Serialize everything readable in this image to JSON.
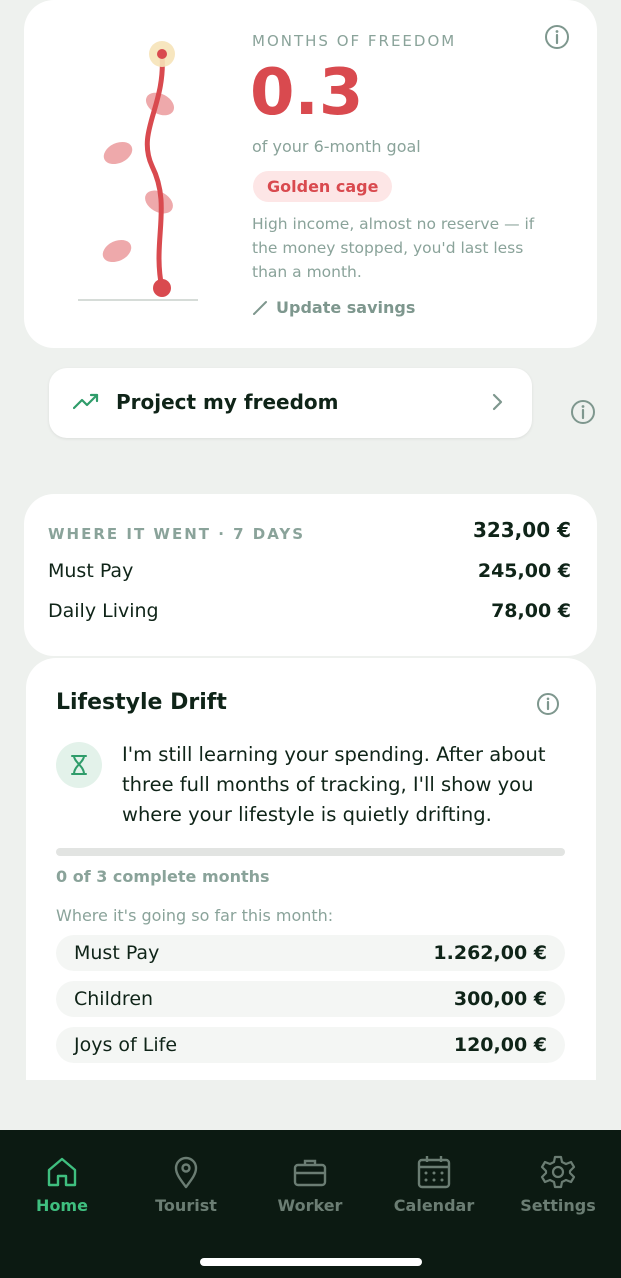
{
  "freedom": {
    "label": "MONTHS OF FREEDOM",
    "value": "0.3",
    "goal_text": "of your 6-month goal",
    "badge": "Golden cage",
    "description": "High income, almost no reserve — if the money stopped, you'd last less than a month.",
    "update_label": "Update savings"
  },
  "project": {
    "label": "Project my freedom"
  },
  "spending": {
    "heading": "WHERE IT WENT · 7 DAYS",
    "total": "323,00 €",
    "rows": [
      {
        "label": "Must Pay",
        "value": "245,00 €"
      },
      {
        "label": "Daily Living",
        "value": "78,00 €"
      }
    ]
  },
  "drift": {
    "title": "Lifestyle Drift",
    "message": "I'm still learning your spending. After about three full months of tracking, I'll show you where your lifestyle is quietly drifting.",
    "progress_fraction": 0,
    "progress_text": "0 of 3 complete months",
    "subheading": "Where it's going so far this month:",
    "rows": [
      {
        "label": "Must Pay",
        "value": "1.262,00 €"
      },
      {
        "label": "Children",
        "value": "300,00 €"
      },
      {
        "label": "Joys of Life",
        "value": "120,00 €"
      }
    ]
  },
  "nav": {
    "items": [
      {
        "label": "Home",
        "icon": "home-icon",
        "active": true
      },
      {
        "label": "Tourist",
        "icon": "map-pin-icon",
        "active": false
      },
      {
        "label": "Worker",
        "icon": "briefcase-icon",
        "active": false
      },
      {
        "label": "Calendar",
        "icon": "calendar-icon",
        "active": false
      },
      {
        "label": "Settings",
        "icon": "gear-icon",
        "active": false
      }
    ]
  },
  "colors": {
    "accent_green": "#3fbf7f",
    "alert_red": "#d94a4f",
    "nav_background": "#0c1a12"
  }
}
